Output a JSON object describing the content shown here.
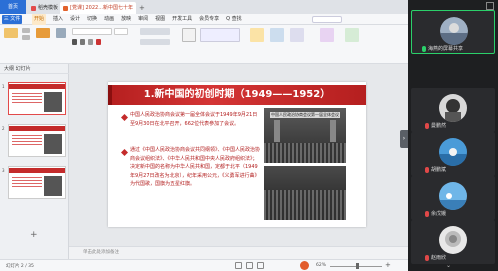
{
  "wps": {
    "tabs": {
      "home": "首页",
      "store": "稻壳模板",
      "doc": "[党课] 2022...新中国七十年"
    },
    "menu": {
      "file": "三 文件",
      "items": [
        "开始",
        "插入",
        "设计",
        "切换",
        "动画",
        "放映",
        "审阅",
        "视图",
        "开发工具",
        "会员专享",
        "Q 查找"
      ],
      "active_index": 0
    },
    "panel": {
      "header": "大纲  幻灯片",
      "thumb_numbers": [
        "1",
        "2",
        "3"
      ]
    },
    "slide": {
      "title": "1.新中国的初创时期（1949——1952）",
      "bullet1": "中国人民政治协商会议第一届全体会议于1949年9月21日至9月30日在北平召开，662位代表参加了会议。",
      "bullet2": "通过《中国人民政治协商会议共同纲领》、《中国人民政治协商会议组织法》、《中华人民共和国中央人民政府组织法》；决定新中国的名称为中华人民共和国，定都于北平（1949年9月27日改名为北京），纪年采用公元，《义勇军进行曲》为代国歌，国旗为五星红旗。",
      "photo_banner": "中国人民政治协商会议第一届全体会议"
    },
    "notes_placeholder": "单击此处添加备注",
    "status": {
      "slide_counter": "幻灯片 2 / 35",
      "zoom": "62%"
    }
  },
  "meeting": {
    "participants": [
      {
        "name": "海燕的屏幕共享",
        "mic": "on",
        "sharing": true
      },
      {
        "name": "曼鹏然",
        "mic": "muted"
      },
      {
        "name": "胡鹏斌",
        "mic": "muted"
      },
      {
        "name": "余戊娥",
        "mic": "muted"
      },
      {
        "name": "赵雨欣",
        "mic": "muted"
      }
    ]
  }
}
